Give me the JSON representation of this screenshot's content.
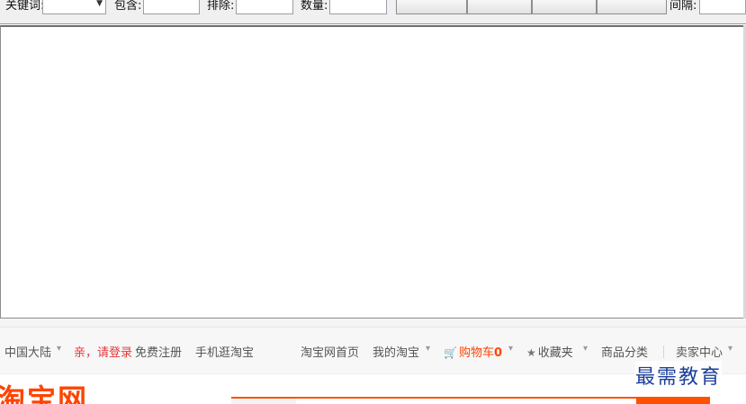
{
  "toolbar": {
    "keyword_label": "关键词:",
    "shop_label": "包含:",
    "exclude_label": "排除:",
    "count_label": "数量:",
    "interval_label": "间隔:"
  },
  "nav": {
    "region": "中国大陆",
    "login_greeting": "亲，请登录",
    "register": "免费注册",
    "mobile": "手机逛淘宝",
    "home": "淘宝网首页",
    "my_taobao": "我的淘宝",
    "cart_label": "购物车",
    "cart_count": "0",
    "favorites": "收藏夹",
    "categories": "商品分类",
    "seller_center": "卖家中心",
    "cart_icon": "shopping-cart-icon",
    "star_icon": "star-icon"
  },
  "logo": {
    "text": "淘宝网"
  },
  "watermark": {
    "text": "最需教育"
  },
  "colors": {
    "taobao_orange": "#ff4400",
    "login_red": "#e4393c",
    "watermark_blue": "#1c3f9c"
  }
}
